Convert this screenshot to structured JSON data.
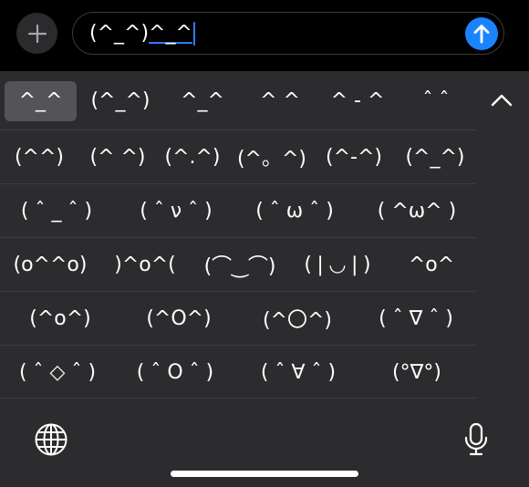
{
  "input": {
    "text_plain": "(^_^)",
    "text_marked": "^_^",
    "plus_icon": "plus-icon",
    "send_icon": "arrow-up-icon",
    "send_color": "#1a84ff",
    "caret_color": "#2e7cf6"
  },
  "candidates": [
    "^_^",
    "(^_^)",
    "^_^",
    "^ ^",
    "^ - ^",
    "ˆ ˆ"
  ],
  "collapse_icon": "chevron-up-icon",
  "emoticons": [
    [
      "(^^)",
      "(^ ^)",
      "(^.^)",
      "(^。^)",
      "(^-^)",
      "(^_^)"
    ],
    [
      "( ˆ _ ˆ )",
      "( ˆ ν ˆ )",
      "( ˆ ω ˆ )",
      "( ^ω^ )"
    ],
    [
      "(o^^o)",
      ")^o^(",
      "(⌒‿⌒)",
      "(❘◡❘)",
      "^o^"
    ],
    [
      "(^o^)",
      "(^O^)",
      "(^〇^)",
      "( ˆ ∇ ˆ )"
    ],
    [
      "( ˆ ◇ ˆ )",
      "( ˆ O ˆ )",
      "( ˆ ∀ ˆ )",
      "(°∇°)"
    ]
  ],
  "bottom": {
    "globe_icon": "globe-icon",
    "mic_icon": "microphone-icon"
  }
}
